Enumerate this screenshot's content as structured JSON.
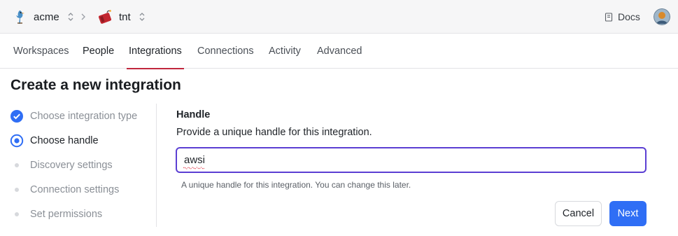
{
  "breadcrumb": {
    "org_name": "acme",
    "workspace_name": "tnt"
  },
  "header": {
    "docs_label": "Docs"
  },
  "tabs": [
    {
      "label": "Workspaces"
    },
    {
      "label": "People"
    },
    {
      "label": "Integrations",
      "active": true
    },
    {
      "label": "Connections"
    },
    {
      "label": "Activity"
    },
    {
      "label": "Advanced"
    }
  ],
  "page": {
    "title": "Create a new integration"
  },
  "steps": [
    {
      "label": "Choose integration type",
      "state": "complete"
    },
    {
      "label": "Choose handle",
      "state": "current"
    },
    {
      "label": "Discovery settings",
      "state": "pending"
    },
    {
      "label": "Connection settings",
      "state": "pending"
    },
    {
      "label": "Set permissions",
      "state": "pending"
    }
  ],
  "form": {
    "label": "Handle",
    "description": "Provide a unique handle for this integration.",
    "value": "awsi",
    "hint": "A unique handle for this integration. You can change this later."
  },
  "actions": {
    "cancel_label": "Cancel",
    "next_label": "Next"
  },
  "colors": {
    "accent": "#c1273d",
    "primary": "#2f6ef5",
    "focus": "#5b3fd3"
  },
  "icons": {
    "org": "bird-logo-icon",
    "workspace": "dynamite-logo-icon",
    "docs": "book-icon"
  }
}
